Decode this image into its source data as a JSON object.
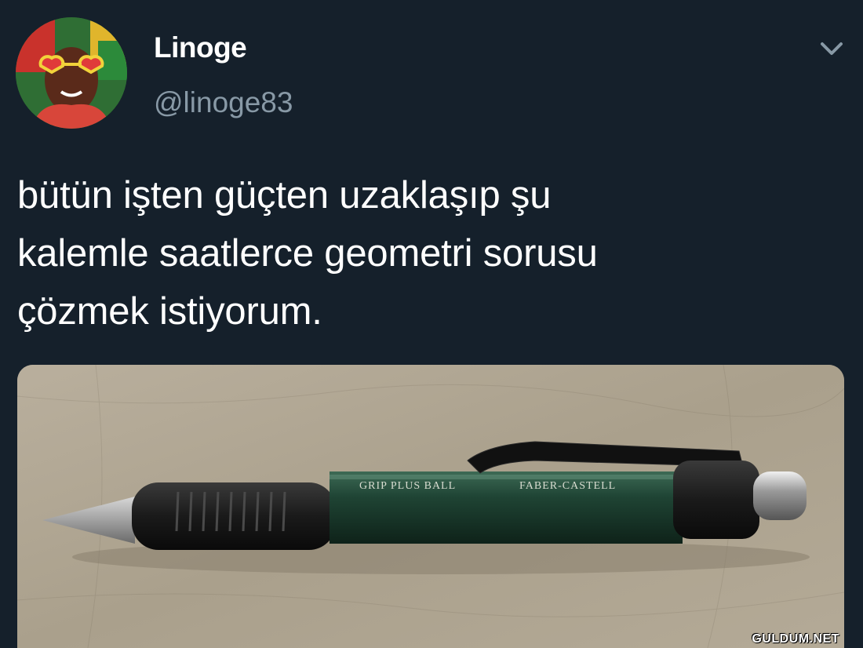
{
  "tweet": {
    "author_name": "Linoge",
    "author_handle": "@linoge83",
    "text_lines": [
      "bütün işten güçten uzaklaşıp şu",
      "kalemle saatlerce geometri sorusu",
      "çözmek istiyorum."
    ],
    "media": {
      "pen_model_text": "GRIP PLUS BALL",
      "pen_brand_text": "FABER-CASTELL"
    },
    "menu_icon": "chevron-down-icon"
  },
  "watermark": "GULDUM.NET",
  "colors": {
    "background": "#15202b",
    "secondary_text": "#8899a6",
    "primary_text": "#ffffff"
  }
}
